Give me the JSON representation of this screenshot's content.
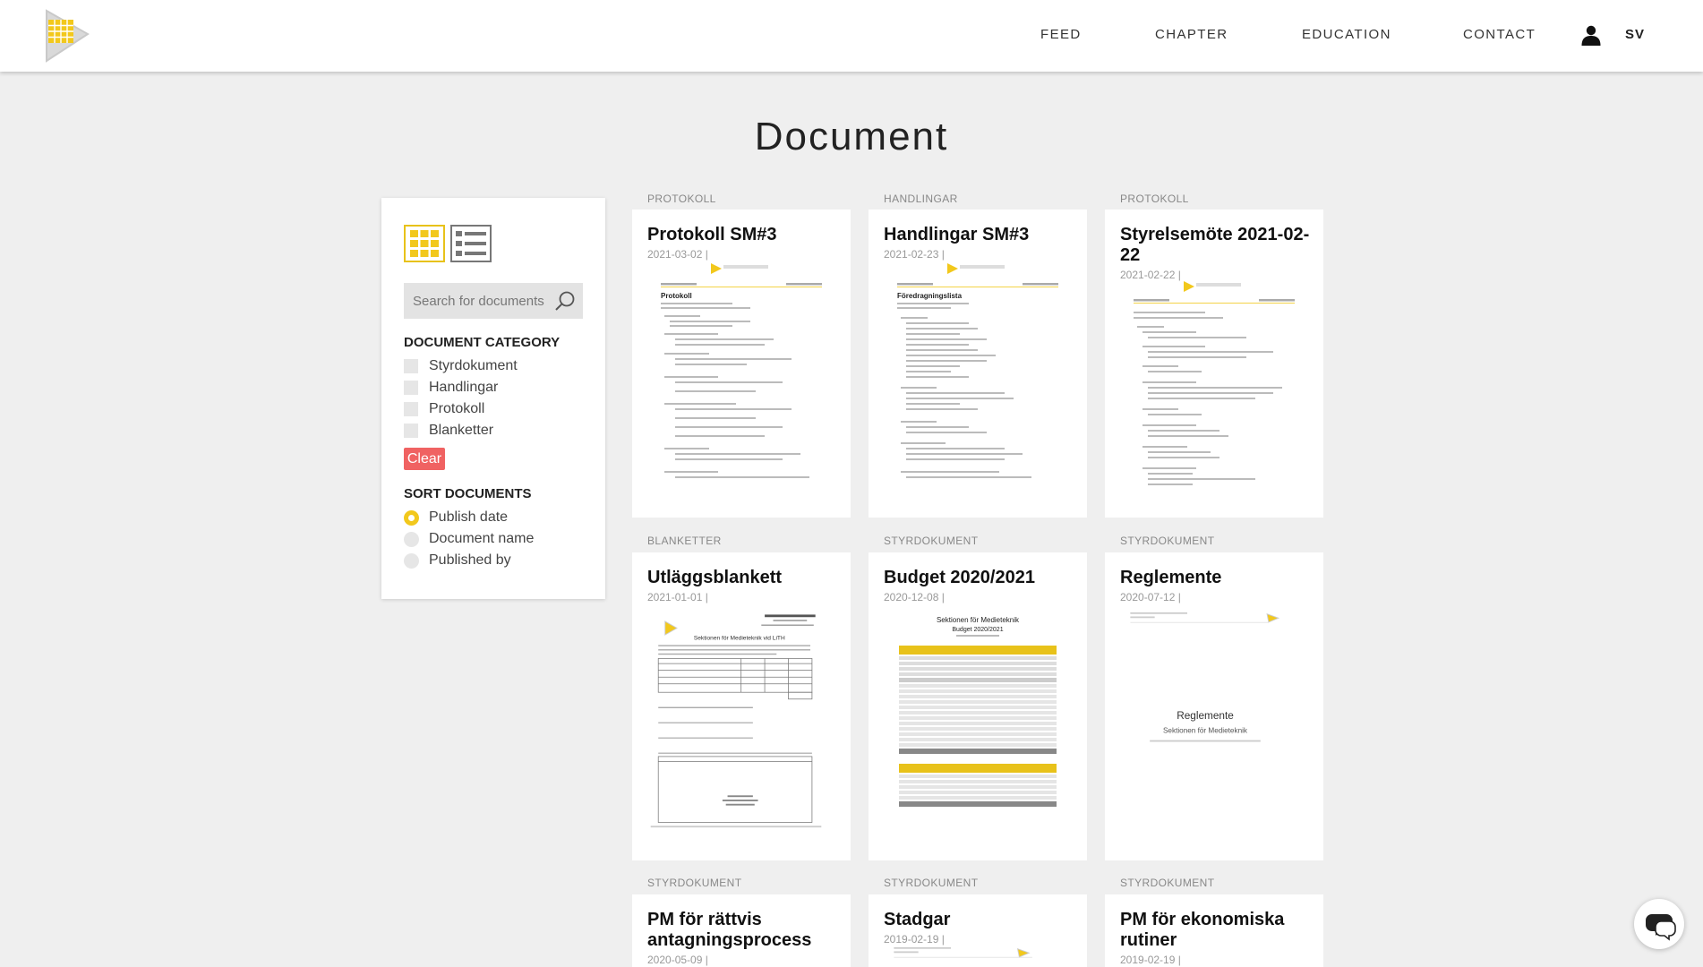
{
  "header": {
    "nav": [
      "FEED",
      "CHAPTER",
      "EDUCATION",
      "CONTACT"
    ],
    "lang": "SV"
  },
  "page": {
    "title": "Document"
  },
  "sidebar": {
    "search_placeholder": "Search for documents",
    "category_heading": "DOCUMENT CATEGORY",
    "categories": [
      "Styrdokument",
      "Handlingar",
      "Protokoll",
      "Blanketter"
    ],
    "clear_label": "Clear",
    "sort_heading": "SORT DOCUMENTS",
    "sort_options": [
      "Publish date",
      "Document name",
      "Published by"
    ],
    "sort_selected": "Publish date"
  },
  "documents": [
    {
      "category": "PROTOKOLL",
      "title": "Protokoll SM#3",
      "date": "2021-03-02 |"
    },
    {
      "category": "HANDLINGAR",
      "title": "Handlingar SM#3",
      "date": "2021-02-23 |"
    },
    {
      "category": "PROTOKOLL",
      "title": "Styrelsemöte 2021-02-22",
      "date": "2021-02-22 |"
    },
    {
      "category": "BLANKETTER",
      "title": "Utläggsblankett",
      "date": "2021-01-01 |"
    },
    {
      "category": "STYRDOKUMENT",
      "title": "Budget 2020/2021",
      "date": "2020-12-08 |"
    },
    {
      "category": "STYRDOKUMENT",
      "title": "Reglemente",
      "date": "2020-07-12 |"
    },
    {
      "category": "STYRDOKUMENT",
      "title": "PM för rättvis antagningsprocess",
      "date": "2020-05-09 |"
    },
    {
      "category": "STYRDOKUMENT",
      "title": "Stadgar",
      "date": "2019-02-19 |"
    },
    {
      "category": "STYRDOKUMENT",
      "title": "PM för ekonomiska rutiner",
      "date": "2019-02-19 |"
    }
  ],
  "thumbnails": {
    "protokoll_heading": "Protokoll",
    "handlingar_heading": "Föredragningslista",
    "budget_title_1": "Sektionen för Medieteknik",
    "budget_title_2": "Budget 2020/2021",
    "reglemente_title": "Reglemente",
    "reglemente_sub": "Sektionen för Medieteknik",
    "utlagg_heading": "Sektionen för Medieteknik vid LiTH"
  },
  "colors": {
    "accent": "#f2c81c",
    "clear": "#f06262"
  }
}
